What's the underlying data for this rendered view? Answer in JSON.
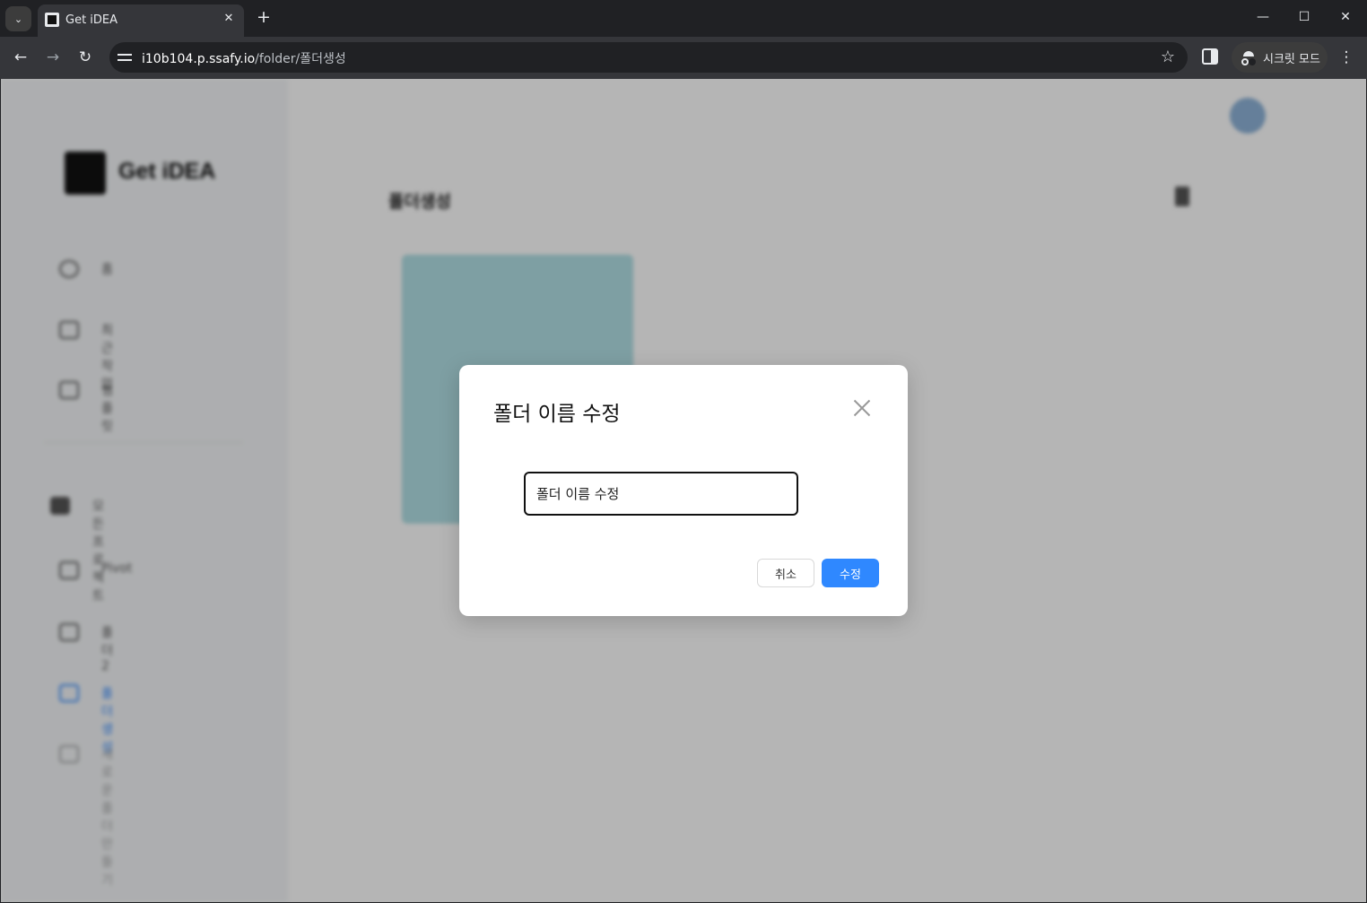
{
  "browser": {
    "tab_title": "Get iDEA",
    "url_host": "i10b104.p.ssafy.io",
    "url_path": "/folder/폴더생성",
    "incognito_label": "시크릿 모드"
  },
  "app": {
    "logo_text": "Get iDEA",
    "sidebar": {
      "items": [
        "홈",
        "최근작업",
        "템플릿",
        "모든 프로젝트",
        "Pivot",
        "폴더2",
        "폴더생성",
        "새로운 폴더 만들기"
      ]
    },
    "main_title": "폴더생성"
  },
  "modal": {
    "title": "폴더 이름 수정",
    "input_value": "폴더 이름 수정",
    "cancel_label": "취소",
    "confirm_label": "수정"
  }
}
